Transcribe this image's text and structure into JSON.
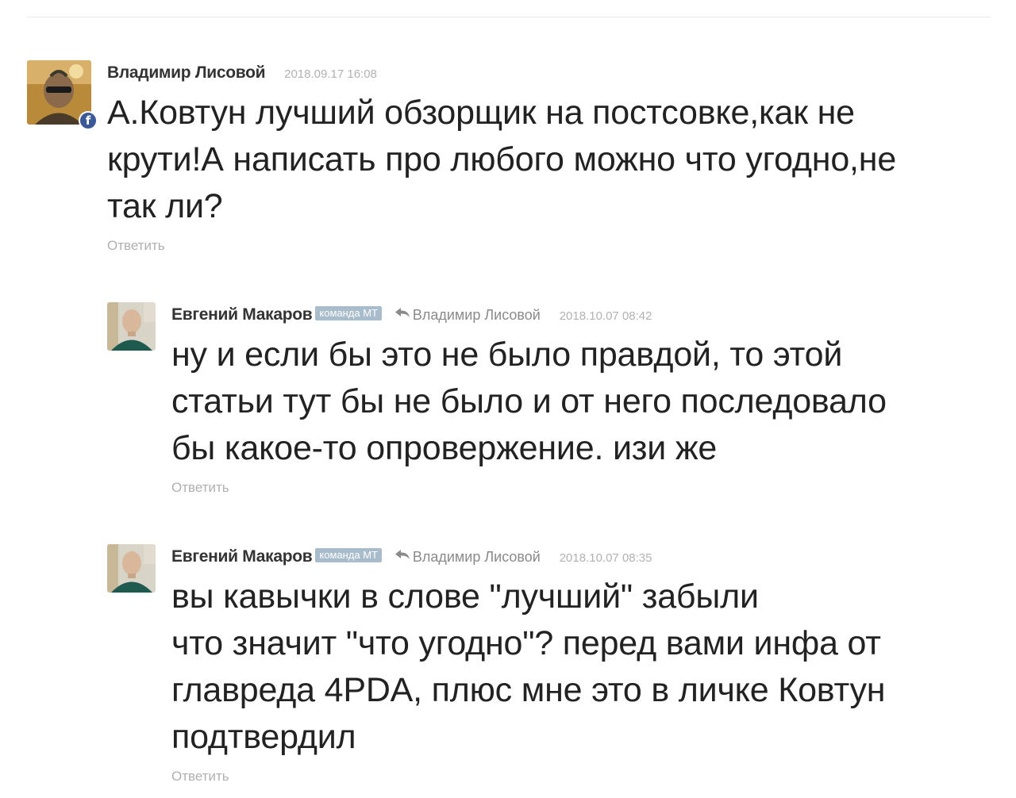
{
  "comments": [
    {
      "author": "Владимир Лисовой",
      "date": "2018.09.17 16:08",
      "text": "А.Ковтун лучший обзорщик на постсовке,как не\nкрути!А написать про любого можно что угодно,не\nтак ли?",
      "reply_label": "Ответить",
      "fb_badge": "f"
    },
    {
      "author": "Евгений Макаров",
      "badge": "команда МТ",
      "reply_to": "Владимир Лисовой",
      "date": "2018.10.07 08:42",
      "text": "ну и если бы это не было правдой, то этой\nстатьи тут бы не было и от него последовало\nбы какое-то опровержение. изи же",
      "reply_label": "Ответить"
    },
    {
      "author": "Евгений Макаров",
      "badge": "команда МТ",
      "reply_to": "Владимир Лисовой",
      "date": "2018.10.07 08:35",
      "text": "вы кавычки в слове \"лучший\" забыли\nчто значит \"что угодно\"? перед вами инфа от\nглавреда 4PDA, плюс мне это в личке Ковтун\nподтвердил",
      "reply_label": "Ответить"
    }
  ],
  "colors": {
    "badge_bg": "#a9bccb",
    "facebook": "#3b5998",
    "meta_gray": "#8a8a8a",
    "date_gray": "#b2b2b2"
  }
}
